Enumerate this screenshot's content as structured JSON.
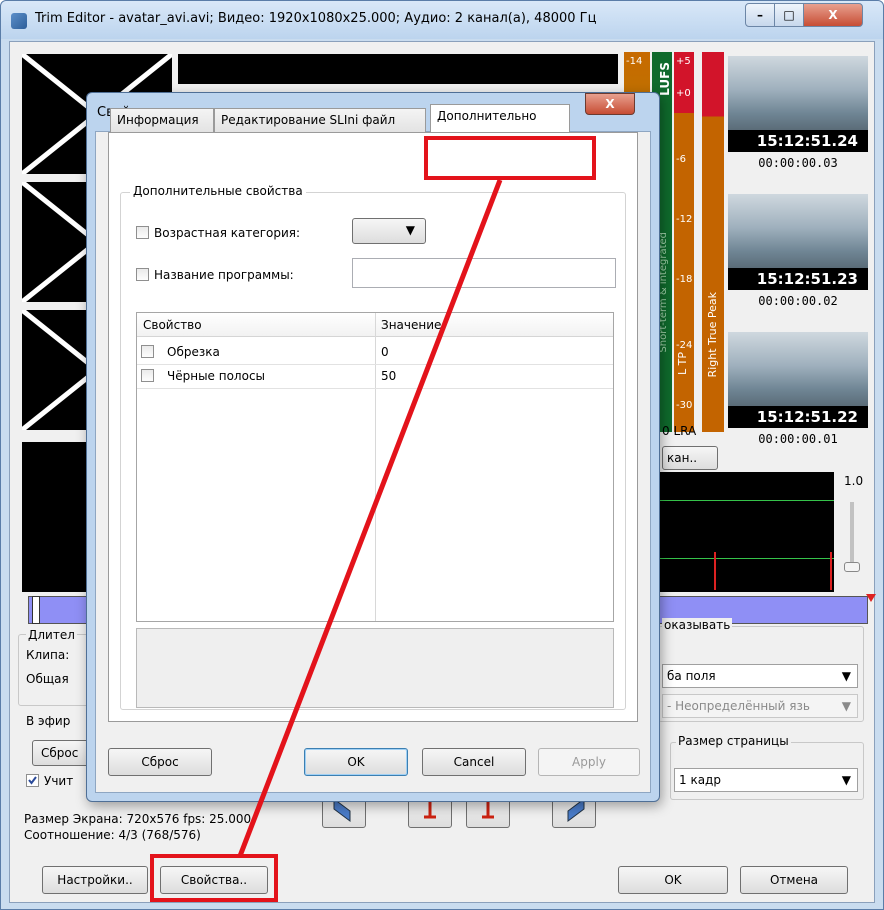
{
  "window": {
    "title": "Trim Editor - avatar_avi.avi; Видео: 1920x1080x25.000; Аудио: 2 канал(а), 48000 Гц",
    "minimize": "–",
    "maximize": "□",
    "close": "X"
  },
  "meter": {
    "ticks_left": [
      "-14"
    ],
    "ticks_right": [
      "+5",
      "+0",
      "-6",
      "-12",
      "-18",
      "-24",
      "-30"
    ],
    "label_lufs": "LUFS",
    "label_ltp": "L TP",
    "label_rtp": "Right True Peak",
    "label_side": "Short-term & integrated",
    "lra": "0 LRA",
    "scan_button": "кан.."
  },
  "thumbnails": [
    {
      "timecode": "15:12:51.24",
      "offset": "00:00:00.03"
    },
    {
      "timecode": "15:12:51.23",
      "offset": "00:00:00.02"
    },
    {
      "timecode": "15:12:51.22",
      "offset": "00:00:00.01"
    }
  ],
  "zoom_value": "1.0",
  "left_panel": {
    "duration_label": "Длител",
    "clip_label": "Клипа:",
    "total_label": "Общая",
    "on_air_label": "В эфир",
    "reset_button": "Сброс",
    "consider_label": "Учит"
  },
  "right_panel": {
    "show_label": "оказывать",
    "fields_value": "ба поля",
    "language_value": "- Неопределённый язь",
    "page_size_label": "Размер страницы",
    "page_size_value": "1 кадр"
  },
  "status": {
    "screen_size": "Размер Экрана: 720x576 fps: 25.000",
    "ratio": "Соотношение: 4/3 (768/576)"
  },
  "bottom": {
    "settings_button": "Настройки..",
    "properties_button": "Свойства..",
    "ok_button": "OK",
    "cancel_button": "Отмена"
  },
  "dialog": {
    "title": "Свойства",
    "close": "X",
    "tabs": [
      "Информация",
      "Редактирование SLIni файл",
      "Дополнительно"
    ],
    "group_title": "Дополнительные свойства",
    "age_label": "Возрастная категория:",
    "program_label": "Название программы:",
    "grid": {
      "col_property": "Свойство",
      "col_value": "Значение",
      "rows": [
        {
          "name": "Обрезка",
          "value": "0"
        },
        {
          "name": "Чёрные полосы",
          "value": "50"
        }
      ]
    },
    "reset_button": "Сброс",
    "ok_button": "OK",
    "cancel_button": "Cancel",
    "apply_button": "Apply"
  },
  "colors": {
    "highlight": "#e3131b",
    "timeline": "#8f8ff5",
    "meter_red": "#d2142a",
    "meter_orange": "#d26b00",
    "meter_green": "#1a8a3a"
  }
}
